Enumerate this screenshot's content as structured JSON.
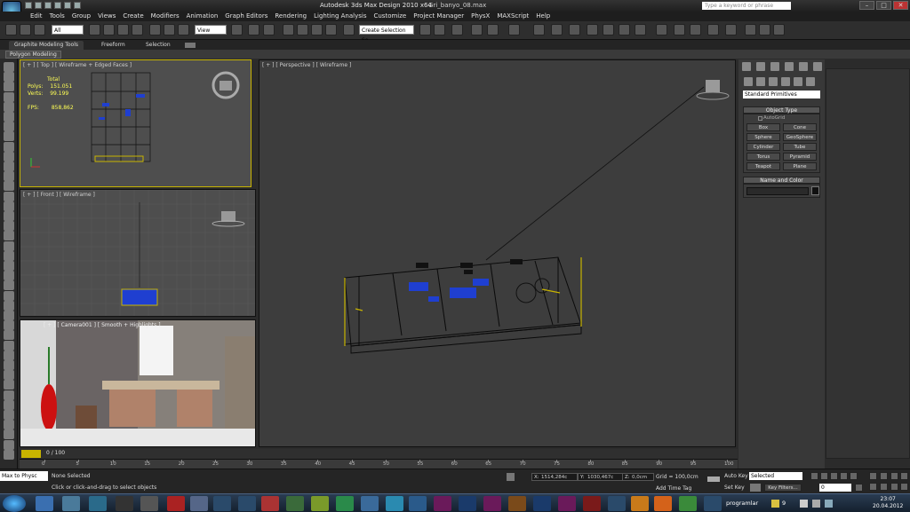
{
  "app": {
    "title": "Autodesk 3ds Max Design 2010 x64",
    "file": "Gri_banyo_08.max"
  },
  "help_search_placeholder": "Type a keyword or phrase",
  "menu": [
    "Edit",
    "Tools",
    "Group",
    "Views",
    "Create",
    "Modifiers",
    "Animation",
    "Graph Editors",
    "Rendering",
    "Lighting Analysis",
    "Customize",
    "Project Manager",
    "PhysX",
    "MAXScript",
    "Help"
  ],
  "toolbar": {
    "filter": "All",
    "ref_coord": "View",
    "named_selection": "Create Selection Se"
  },
  "ribbon": {
    "tabs": [
      "Graphite Modeling Tools",
      "Freeform",
      "Selection"
    ],
    "subtab": "Polygon Modeling"
  },
  "viewports": {
    "top": {
      "label": "[ + ] [ Top ] [ Wireframe + Edged Faces ]"
    },
    "front": {
      "label": "[ + ] [ Front ] [ Wireframe ]"
    },
    "camera": {
      "label": "[ + ] [ Camera001 ] [ Smooth + Highlights ]"
    },
    "perspective": {
      "label": "[ + ] [ Perspective ] [ Wireframe ]"
    }
  },
  "stats": {
    "total_label": "Total",
    "polys_label": "Polys:",
    "polys": "151.051",
    "verts_label": "Verts:",
    "verts": "99.199",
    "fps_label": "FPS:",
    "fps": "858,862"
  },
  "command_panel": {
    "category": "Standard Primitives",
    "object_type_title": "Object Type",
    "autogrid": "AutoGrid",
    "buttons": [
      "Box",
      "Cone",
      "Sphere",
      "GeoSphere",
      "Cylinder",
      "Tube",
      "Torus",
      "Pyramid",
      "Teapot",
      "Plane"
    ],
    "name_color_title": "Name and Color"
  },
  "timeline": {
    "frame": "0 / 100",
    "ticks": [
      "0",
      "5",
      "10",
      "15",
      "20",
      "25",
      "30",
      "35",
      "40",
      "45",
      "50",
      "55",
      "60",
      "65",
      "70",
      "75",
      "80",
      "85",
      "90",
      "95",
      "100"
    ]
  },
  "status": {
    "maxscript": "Max to Physc",
    "selection": "None Selected",
    "prompt": "Click or click-and-drag to select objects",
    "x_label": "X:",
    "x": "1514,284c",
    "y_label": "Y:",
    "y": "1030,467c",
    "z_label": "Z:",
    "z": "0,0cm",
    "grid": "Grid = 100,0cm",
    "add_time_tag": "Add Time Tag",
    "auto_key": "Auto Key",
    "set_key": "Set Key",
    "key_mode": "Selected",
    "key_filters": "Key Filters...",
    "frame_field": "0"
  },
  "taskbar": {
    "tray_label": "programlar",
    "count": "9",
    "time": "23:07",
    "date": "20.04.2012"
  },
  "colors": {
    "accent_yellow": "#c8b400",
    "selection_blue": "#1f3fd0",
    "vase_red": "#cc1111"
  }
}
